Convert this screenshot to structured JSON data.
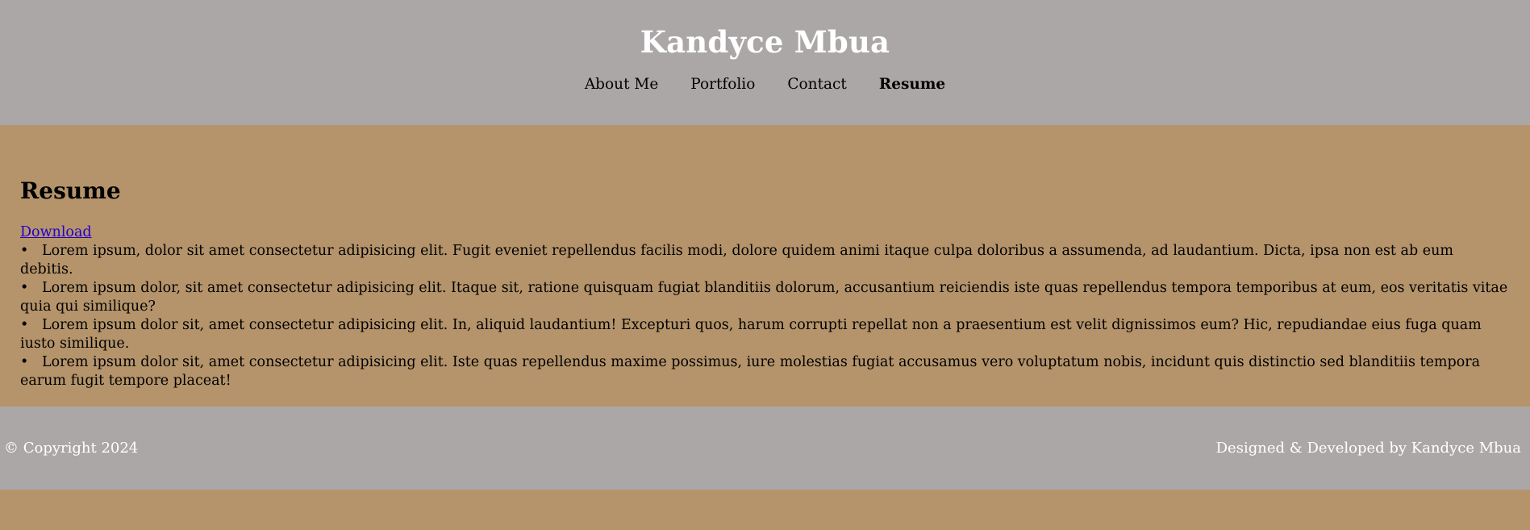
{
  "header": {
    "title": "Kandyce Mbua",
    "nav": [
      {
        "label": "About Me",
        "active": false
      },
      {
        "label": "Portfolio",
        "active": false
      },
      {
        "label": "Contact",
        "active": false
      },
      {
        "label": "Resume",
        "active": true
      }
    ]
  },
  "main": {
    "section_title": "Resume",
    "download_label": "Download",
    "bullet_glyph": "•",
    "items": [
      "Lorem ipsum, dolor sit amet consectetur adipisicing elit. Fugit eveniet repellendus facilis modi, dolore quidem animi itaque culpa doloribus a assumenda, ad laudantium. Dicta, ipsa non est ab eum debitis.",
      "Lorem ipsum dolor, sit amet consectetur adipisicing elit. Itaque sit, ratione quisquam fugiat blanditiis dolorum, accusantium reiciendis iste quas repellendus tempora temporibus at eum, eos veritatis vitae quia qui similique?",
      "Lorem ipsum dolor sit, amet consectetur adipisicing elit. In, aliquid laudantium! Excepturi quos, harum corrupti repellat non a praesentium est velit dignissimos eum? Hic, repudiandae eius fuga quam iusto similique.",
      "Lorem ipsum dolor sit, amet consectetur adipisicing elit. Iste quas repellendus maxime possimus, iure molestias fugiat accusamus vero voluptatum nobis, incidunt quis distinctio sed blanditiis tempora earum fugit tempore placeat!"
    ]
  },
  "footer": {
    "copyright": "© Copyright 2024",
    "credit": "Designed & Developed by Kandyce Mbua"
  },
  "colors": {
    "header_bg": "#aba7a7",
    "main_bg": "#b5946b",
    "footer_bg": "#aba7a7",
    "link": "#2200cc",
    "title_text": "#ffffff"
  }
}
